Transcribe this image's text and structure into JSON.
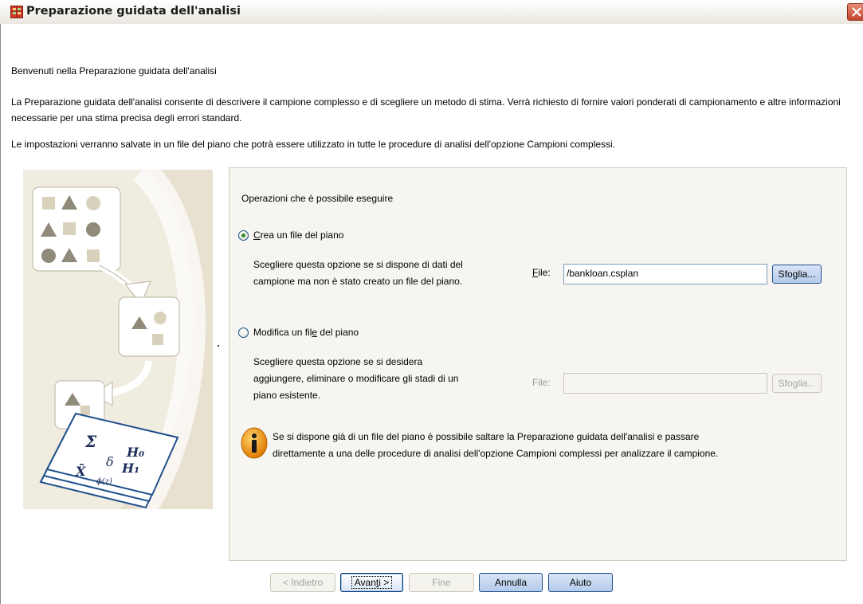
{
  "window": {
    "title": "Preparazione guidata dell'analisi"
  },
  "intro": {
    "heading": "Benvenuti nella Preparazione guidata dell'analisi",
    "paragraph1": "La Preparazione guidata dell'analisi consente di descrivere il campione complesso e di scegliere un metodo di stima. Verrà richiesto di fornire valori ponderati di campionamento e altre informazioni necessarie per una stima precisa degli errori standard.",
    "paragraph2": "Le impostazioni verranno salvate in un file del piano che potrà essere utilizzato in tutte le procedure di analisi dell'opzione Campioni complessi."
  },
  "panel": {
    "question": "Operazioni che è possibile eseguire",
    "option_create": {
      "label_mnemonic": "C",
      "label_rest": "rea un file del piano",
      "selected": true,
      "description_line1": "Scegliere questa opzione se si dispone di dati del",
      "description_line2": "campione ma non è stato creato un file del piano.",
      "file_label_mnemonic": "F",
      "file_label_rest": "ile:",
      "file_value": "/bankloan.csplan",
      "browse_label": "Sfoglia..."
    },
    "option_modify": {
      "label_pre": "Modifica un fil",
      "label_mnemonic": "e",
      "label_post": " del piano",
      "selected": false,
      "description_line1": "Scegliere questa opzione se si desidera",
      "description_line2": "aggiungere, eliminare o modificare gli stadi di un",
      "description_line3": "piano esistente.",
      "file_label": "File:",
      "file_value": "",
      "browse_label": "Sfoglia..."
    },
    "info": {
      "line1": "Se si dispone già di un file del piano è possibile saltare la Preparazione guidata dell'analisi e passare",
      "line2": "direttamente a una delle procedure di analisi dell'opzione Campioni complessi per analizzare il campione."
    }
  },
  "buttons": {
    "back": "< Indietro",
    "next_pre": "Avan",
    "next_mnemonic": "t",
    "next_post": "i >",
    "finish": "Fine",
    "cancel": "Annulla",
    "help": "Aiuto"
  },
  "graphic": {
    "formula_sigma": "Σ",
    "formula_h0": "H₀",
    "formula_delta": "δ",
    "formula_h1": "H₁",
    "formula_xbar": "X̄",
    "formula_phi": "ϕ(z)"
  },
  "colors": {
    "accent_blue": "#1f4f8c",
    "close_red": "#c4452e",
    "graphic_bg": "#f1ece0",
    "radio_selected": "#2f8b1f"
  }
}
